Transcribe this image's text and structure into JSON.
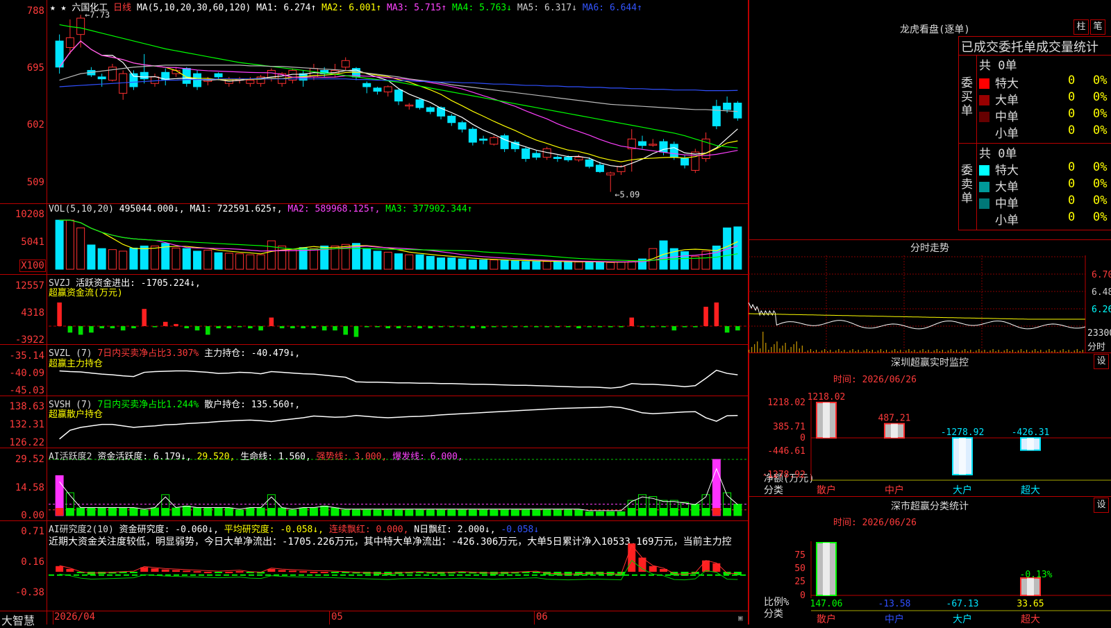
{
  "header": {
    "stars": "★ ★",
    "stock_name": "六国化工",
    "period": "日线",
    "ma_label": "MA(5,10,20,30,60,120)",
    "ma_items": [
      {
        "text": "MA1: 6.274↑",
        "color": "#ffffff"
      },
      {
        "text": "MA2: 6.001↑",
        "color": "#ffff00"
      },
      {
        "text": "MA3: 5.715↑",
        "color": "#ff40ff"
      },
      {
        "text": "MA4: 5.763↓",
        "color": "#00ff00"
      },
      {
        "text": "MA5: 6.317↓",
        "color": "#cccccc"
      },
      {
        "text": "MA6: 6.644↑",
        "color": "#3050ff"
      }
    ]
  },
  "price_axis": [
    "788",
    "695",
    "602",
    "509"
  ],
  "price_annotations": {
    "high": "7.73",
    "low": "5.09"
  },
  "vol_header": [
    {
      "text": "VOL(5,10,20)",
      "color": "#dddddd"
    },
    {
      "text": "495044.000↓,",
      "color": "#ffffff"
    },
    {
      "text": "MA1: 722591.625↑,",
      "color": "#ffffff"
    },
    {
      "text": "MA2: 589968.125↑,",
      "color": "#ff40ff"
    },
    {
      "text": "MA3: 377902.344↑",
      "color": "#00ff00"
    }
  ],
  "vol_axis": [
    "10208",
    "5041",
    "X100"
  ],
  "svzj_header": [
    {
      "text": "SVZJ",
      "color": "#dddddd"
    },
    {
      "text": "活跃资金进出: -1705.224↓,",
      "color": "#ffffff"
    }
  ],
  "svzj_title": "超赢资金流(万元)",
  "svzj_axis": [
    "12557",
    "4318",
    "-3922"
  ],
  "svzl_header": [
    {
      "text": "SVZL (7)",
      "color": "#dddddd"
    },
    {
      "text": "7日内买卖净占比3.307%",
      "color": "#ff3b3b"
    },
    {
      "text": "主力持仓: -40.479↓,",
      "color": "#ffffff"
    }
  ],
  "svzl_title": "超赢主力持仓",
  "svzl_axis": [
    "-35.14",
    "-40.09",
    "-45.03"
  ],
  "svsh_header": [
    {
      "text": "SVSH (7)",
      "color": "#dddddd"
    },
    {
      "text": "7日内买卖净占比1.244%",
      "color": "#00ff00"
    },
    {
      "text": "散户持仓: 135.560↑,",
      "color": "#ffffff"
    }
  ],
  "svsh_title": "超赢散户持仓",
  "svsh_axis": [
    "138.63",
    "132.31",
    "126.22"
  ],
  "ai_header": [
    {
      "text": "AI活跃度2",
      "color": "#dddddd"
    },
    {
      "text": "资金活跃度: 6.179↓,",
      "color": "#ffffff"
    },
    {
      "text": "29.520,",
      "color": "#ffff00"
    },
    {
      "text": "生命线: 1.560,",
      "color": "#ffffff"
    },
    {
      "text": "强势线: 3.000,",
      "color": "#ff3b3b"
    },
    {
      "text": "爆发线: 6.000,",
      "color": "#ff40ff"
    }
  ],
  "ai_axis": [
    "29.52",
    "14.58",
    "0.00"
  ],
  "yj_header": [
    {
      "text": "AI研究度2(10)",
      "color": "#dddddd"
    },
    {
      "text": "资金研究度: -0.060↓,",
      "color": "#ffffff"
    },
    {
      "text": "平均研究度: -0.058↓,",
      "color": "#ffff00"
    },
    {
      "text": "连续飘红: 0.000,",
      "color": "#ff3b3b"
    },
    {
      "text": "N日飘红: 2.000↓,",
      "color": "#ffffff"
    },
    {
      "text": "-0.058↓",
      "color": "#3050ff"
    }
  ],
  "yj_comment": "近期大资金关注度较低，明显弱势，今日大单净流出：-1705.226万元，其中特大单净流出：-426.306万元，大单5日累计净入10533.169万元，当前主力控",
  "yj_axis": [
    "0.71",
    "0.16",
    "-0.38"
  ],
  "x_axis": {
    "logo": "大智慧",
    "labels": [
      "2026/04",
      "05",
      "06"
    ]
  },
  "dragon": {
    "title": "龙虎看盘(逐单)",
    "btn_zhu": "柱",
    "btn_bi": "笔",
    "tabs_line": "已成交委托单成交量统计",
    "buy": {
      "side": "委买单",
      "total": "共 0单",
      "rows": [
        {
          "label": "特大",
          "count": "0",
          "pct": "0%",
          "color": "#ff0000"
        },
        {
          "label": "大单",
          "count": "0",
          "pct": "0%",
          "color": "#990000"
        },
        {
          "label": "中单",
          "count": "0",
          "pct": "0%",
          "color": "#660000"
        },
        {
          "label": "小单",
          "count": "0",
          "pct": "0%",
          "color": "#000000"
        }
      ]
    },
    "sell": {
      "side": "委卖单",
      "total": "共 0单",
      "rows": [
        {
          "label": "特大",
          "count": "0",
          "pct": "0%",
          "color": "#00ffff"
        },
        {
          "label": "大单",
          "count": "0",
          "pct": "0%",
          "color": "#009999"
        },
        {
          "label": "中单",
          "count": "0",
          "pct": "0%",
          "color": "#007777"
        },
        {
          "label": "小单",
          "count": "0",
          "pct": "0%",
          "color": "#000000"
        }
      ]
    }
  },
  "fenshi": {
    "title": "分时走势",
    "axis": [
      "6.70",
      "6.48",
      "6.26",
      "23300",
      "分时"
    ]
  },
  "realtime": {
    "title": "深圳超赢实时监控",
    "settings": "设",
    "time": "时间: 2026/06/26",
    "axis": [
      "1218.02",
      "385.71",
      "0",
      "-446.61",
      "-1278.92"
    ],
    "ylabel": "净额(万元)",
    "xlabel": "分类",
    "chart_data": {
      "type": "bar",
      "categories": [
        "散户",
        "中户",
        "大户",
        "超大"
      ],
      "values": [
        1218.02,
        487.21,
        -1278.92,
        -426.31
      ],
      "value_labels": [
        "1218.02",
        "487.21",
        "-1278.92",
        "-426.31"
      ],
      "ylim": [
        -1278.92,
        1218.02
      ]
    }
  },
  "classify": {
    "title": "深市超赢分类统计",
    "settings": "设",
    "time": "时间: 2026/06/26",
    "axis": [
      "75",
      "50",
      "25",
      "0"
    ],
    "ylabel": "比例%",
    "xlabel": "分类",
    "chart_data": {
      "type": "bar",
      "categories": [
        "散户",
        "中户",
        "大户",
        "超大"
      ],
      "values": [
        147.06,
        -13.58,
        -67.13,
        33.65
      ],
      "value_labels": [
        "147.06",
        "-13.58",
        "-67.13",
        "33.65"
      ],
      "bar_pct": [
        100,
        0,
        0,
        33
      ],
      "annotation": "-0.13%",
      "ylim": [
        0,
        100
      ]
    }
  },
  "chart_data": {
    "type": "candlestick",
    "title": "六国化工 日线",
    "x_labels": [
      "2026/04",
      "05",
      "06"
    ],
    "ylim": [
      5.09,
      7.88
    ],
    "open": [
      7.4,
      7.3,
      7.5,
      6.95,
      6.85,
      6.8,
      6.6,
      6.9,
      6.92,
      6.75,
      6.92,
      6.9,
      6.98,
      6.9,
      6.78,
      6.9,
      6.75,
      6.8,
      6.75,
      6.75,
      6.82,
      6.75,
      6.8,
      6.9,
      6.85,
      6.95,
      6.9,
      7.0,
      6.98,
      6.75,
      6.68,
      6.62,
      6.65,
      6.42,
      6.5,
      6.38,
      6.38,
      6.25,
      6.15,
      6.05,
      5.9,
      5.82,
      5.95,
      5.85,
      5.75,
      5.68,
      5.62,
      5.62,
      5.62,
      5.58,
      5.58,
      5.5,
      5.35,
      5.4,
      5.75,
      5.86,
      5.82,
      5.86,
      5.82,
      5.6,
      5.42,
      5.6,
      6.4,
      6.45,
      6.45
    ],
    "close": [
      7.0,
      7.45,
      7.75,
      6.88,
      6.82,
      7.0,
      6.9,
      6.7,
      6.82,
      6.85,
      6.8,
      6.95,
      6.75,
      6.7,
      6.8,
      6.85,
      6.82,
      6.82,
      6.8,
      6.85,
      6.95,
      6.9,
      6.95,
      6.8,
      6.98,
      6.9,
      6.95,
      7.1,
      6.85,
      6.7,
      6.63,
      6.7,
      6.48,
      6.42,
      6.38,
      6.32,
      6.25,
      6.15,
      6.05,
      5.85,
      5.88,
      5.92,
      5.75,
      5.75,
      5.6,
      5.62,
      5.75,
      5.6,
      5.58,
      5.62,
      5.48,
      5.4,
      5.38,
      5.48,
      5.9,
      5.8,
      5.82,
      5.7,
      5.62,
      5.5,
      5.7,
      5.9,
      6.1,
      6.35,
      6.22
    ],
    "high": [
      7.5,
      7.73,
      7.8,
      7.0,
      6.9,
      7.05,
      6.95,
      6.95,
      7.2,
      6.9,
      6.98,
      7.0,
      7.0,
      6.95,
      6.85,
      6.92,
      6.85,
      6.85,
      6.85,
      6.88,
      6.98,
      6.92,
      6.98,
      6.95,
      7.05,
      7.0,
      7.05,
      7.15,
      7.0,
      6.78,
      6.7,
      6.72,
      6.68,
      6.45,
      6.52,
      6.4,
      6.4,
      6.28,
      6.18,
      6.08,
      5.95,
      5.95,
      5.98,
      5.88,
      5.78,
      5.72,
      5.78,
      5.65,
      5.65,
      5.66,
      5.62,
      5.55,
      5.4,
      5.5,
      6.05,
      5.95,
      5.9,
      5.9,
      5.86,
      5.65,
      5.75,
      6.0,
      6.5,
      6.55,
      6.48
    ],
    "low": [
      6.9,
      7.2,
      7.3,
      6.85,
      6.7,
      6.78,
      6.5,
      6.65,
      6.75,
      6.7,
      6.72,
      6.85,
      6.7,
      6.65,
      6.72,
      6.8,
      6.7,
      6.75,
      6.7,
      6.7,
      6.78,
      6.7,
      6.75,
      6.7,
      6.8,
      6.85,
      6.85,
      6.95,
      6.8,
      6.6,
      6.58,
      6.55,
      6.42,
      6.35,
      6.35,
      6.28,
      6.2,
      6.1,
      6.0,
      5.8,
      5.82,
      5.8,
      5.7,
      5.7,
      5.55,
      5.58,
      5.58,
      5.55,
      5.55,
      5.55,
      5.45,
      5.38,
      5.09,
      5.35,
      5.4,
      5.75,
      5.78,
      5.65,
      5.58,
      5.45,
      5.38,
      5.55,
      6.05,
      6.3,
      6.18
    ],
    "ma_series": [
      {
        "name": "MA1",
        "color": "#ffffff"
      },
      {
        "name": "MA2",
        "color": "#ffff00"
      },
      {
        "name": "MA3",
        "color": "#ff40ff"
      },
      {
        "name": "MA4",
        "color": "#00ff00"
      },
      {
        "name": "MA5",
        "color": "#cccccc"
      },
      {
        "name": "MA6",
        "color": "#3050ff"
      }
    ],
    "ma5_line": [
      6.8,
      6.85,
      6.9,
      6.92,
      6.94,
      6.96,
      6.98,
      7.0,
      7.01,
      7.02,
      7.03,
      7.03,
      7.03,
      7.03,
      7.03,
      7.03,
      7.03,
      7.03,
      7.02,
      7.02,
      7.01,
      7.01,
      7.0,
      6.99,
      6.98,
      6.97,
      6.96,
      6.95,
      6.93,
      6.91,
      6.89,
      6.87,
      6.85,
      6.82,
      6.8,
      6.78,
      6.76,
      6.73,
      6.71,
      6.69,
      6.67,
      6.65,
      6.63,
      6.61,
      6.59,
      6.57,
      6.55,
      6.53,
      6.51,
      6.49,
      6.47,
      6.45,
      6.43,
      6.42,
      6.41,
      6.4,
      6.39,
      6.38,
      6.37,
      6.36,
      6.35,
      6.35,
      6.34,
      6.33,
      6.32
    ],
    "ma6_line": [
      6.7,
      6.71,
      6.72,
      6.73,
      6.74,
      6.75,
      6.76,
      6.77,
      6.78,
      6.79,
      6.8,
      6.8,
      6.81,
      6.81,
      6.81,
      6.82,
      6.82,
      6.82,
      6.82,
      6.82,
      6.82,
      6.82,
      6.82,
      6.82,
      6.82,
      6.82,
      6.82,
      6.82,
      6.81,
      6.81,
      6.8,
      6.8,
      6.79,
      6.79,
      6.78,
      6.78,
      6.77,
      6.77,
      6.76,
      6.76,
      6.75,
      6.74,
      6.74,
      6.73,
      6.72,
      6.72,
      6.71,
      6.71,
      6.7,
      6.7,
      6.69,
      6.69,
      6.68,
      6.68,
      6.67,
      6.67,
      6.66,
      6.66,
      6.65,
      6.65,
      6.65,
      6.64,
      6.64,
      6.64,
      6.644
    ],
    "ma4_line": [
      7.65,
      7.62,
      7.6,
      7.56,
      7.52,
      7.48,
      7.44,
      7.4,
      7.36,
      7.32,
      7.28,
      7.25,
      7.22,
      7.19,
      7.16,
      7.13,
      7.1,
      7.07,
      7.05,
      7.03,
      7.01,
      6.99,
      6.97,
      6.95,
      6.93,
      6.91,
      6.89,
      6.87,
      6.85,
      6.83,
      6.81,
      6.79,
      6.77,
      6.74,
      6.71,
      6.68,
      6.65,
      6.62,
      6.59,
      6.56,
      6.53,
      6.5,
      6.47,
      6.44,
      6.41,
      6.38,
      6.35,
      6.32,
      6.29,
      6.26,
      6.23,
      6.2,
      6.17,
      6.14,
      6.11,
      6.08,
      6.05,
      6.02,
      5.99,
      5.95,
      5.9,
      5.85,
      5.8,
      5.78,
      5.763
    ],
    "volume": [
      95,
      95,
      80,
      47,
      40,
      38,
      35,
      41,
      45,
      45,
      50,
      41,
      40,
      35,
      37,
      32,
      31,
      30,
      28,
      28,
      55,
      45,
      38,
      42,
      40,
      45,
      45,
      48,
      50,
      40,
      35,
      33,
      30,
      28,
      28,
      25,
      22,
      22,
      20,
      18,
      18,
      18,
      17,
      16,
      15,
      15,
      15,
      15,
      14,
      14,
      14,
      14,
      13,
      14,
      15,
      20,
      40,
      55,
      40,
      34,
      25,
      35,
      45,
      80,
      82
    ],
    "volume_unit": "X100",
    "svzj": [
      11,
      -3,
      -4,
      -3,
      -1,
      -1,
      -2,
      -1,
      8,
      -0.5,
      2,
      1,
      -1,
      -2,
      -4,
      -1,
      -1,
      -0.5,
      -1,
      -2,
      4,
      -1,
      -1,
      -1,
      -1,
      -2,
      -2,
      -4,
      -5,
      -0.5,
      -0.5,
      -1,
      -1,
      -0.5,
      -1,
      -1,
      -0.5,
      -0.5,
      -0.5,
      -1,
      -1,
      -0.5,
      -0.5,
      -0.5,
      -0.5,
      -0.5,
      -0.5,
      -0.5,
      -0.5,
      -1,
      -0.5,
      -0.5,
      -0.5,
      -0.5,
      4,
      -0.5,
      -0.5,
      -0.5,
      -2,
      -0.5,
      -0.5,
      9,
      11,
      -3,
      -2
    ],
    "svzl": [
      -39.4,
      -39.6,
      -39.7,
      -40.0,
      -40.3,
      -40.5,
      -40.8,
      -41.0,
      -39.8,
      -39.6,
      -39.5,
      -39.4,
      -39.4,
      -39.6,
      -39.8,
      -40.1,
      -40.0,
      -39.8,
      -39.9,
      -40.2,
      -39.6,
      -39.8,
      -40.0,
      -40.2,
      -40.3,
      -40.6,
      -40.9,
      -41.2,
      -42.5,
      -42.6,
      -42.6,
      -42.7,
      -42.8,
      -42.8,
      -42.9,
      -42.9,
      -43.0,
      -43.0,
      -43.1,
      -43.2,
      -43.2,
      -43.3,
      -43.4,
      -43.5,
      -43.5,
      -43.6,
      -43.7,
      -43.8,
      -43.9,
      -44.0,
      -44.0,
      -44.1,
      -44.3,
      -44.0,
      -43.0,
      -43.2,
      -43.2,
      -43.4,
      -43.6,
      -43.9,
      -43.6,
      -41.5,
      -39.2,
      -40.1,
      -40.5
    ],
    "svsh": [
      127.5,
      130.5,
      131.5,
      132.0,
      132.5,
      132.5,
      132.0,
      131.5,
      131.8,
      132.0,
      132.4,
      132.5,
      132.8,
      133.0,
      133.2,
      133.5,
      133.7,
      133.9,
      134.0,
      133.8,
      133.5,
      134.0,
      134.4,
      134.8,
      135.4,
      135.2,
      135.0,
      135.1,
      135.6,
      135.3,
      135.0,
      134.8,
      135.0,
      135.2,
      135.3,
      135.5,
      135.8,
      136.0,
      136.2,
      136.4,
      136.6,
      136.8,
      137.0,
      137.2,
      137.4,
      137.6,
      137.8,
      138.0,
      138.1,
      138.2,
      138.3,
      138.4,
      138.6,
      138.3,
      137.5,
      136.5,
      136.2,
      136.4,
      136.6,
      136.8,
      136.9,
      134.8,
      133.6,
      135.5,
      135.6
    ],
    "ai_active": [
      21,
      12,
      4,
      4,
      4,
      4,
      4,
      4,
      3,
      4,
      11,
      4,
      5,
      4,
      4,
      4,
      4,
      3,
      4,
      4,
      11,
      4,
      3,
      4,
      4,
      5,
      4,
      3,
      3,
      3,
      3,
      3,
      3,
      3,
      3,
      3,
      3,
      3,
      3,
      3,
      3,
      3,
      3,
      3,
      3,
      3,
      3,
      3,
      3,
      3,
      2,
      2,
      2,
      2,
      8,
      11,
      10,
      8,
      8,
      7,
      6,
      11,
      29.5,
      12,
      6
    ],
    "yj_research": [
      0.1,
      0.05,
      -0.02,
      -0.05,
      -0.04,
      -0.03,
      -0.02,
      -0.01,
      0.08,
      0.06,
      0.04,
      0.03,
      0.02,
      0.01,
      0.0,
      -0.01,
      0.0,
      0.01,
      -0.02,
      -0.03,
      0.05,
      0.03,
      0.02,
      0.01,
      0.0,
      0.0,
      -0.01,
      -0.02,
      -0.03,
      -0.04,
      -0.05,
      -0.06,
      -0.04,
      -0.03,
      -0.02,
      -0.03,
      -0.04,
      -0.03,
      -0.02,
      -0.03,
      -0.04,
      -0.05,
      -0.04,
      -0.03,
      -0.02,
      -0.01,
      -0.05,
      -0.06,
      -0.07,
      -0.06,
      -0.05,
      -0.05,
      -0.06,
      -0.07,
      0.5,
      0.25,
      0.1,
      0.05,
      -0.06,
      -0.07,
      -0.04,
      0.2,
      0.15,
      -0.05,
      -0.06
    ]
  }
}
